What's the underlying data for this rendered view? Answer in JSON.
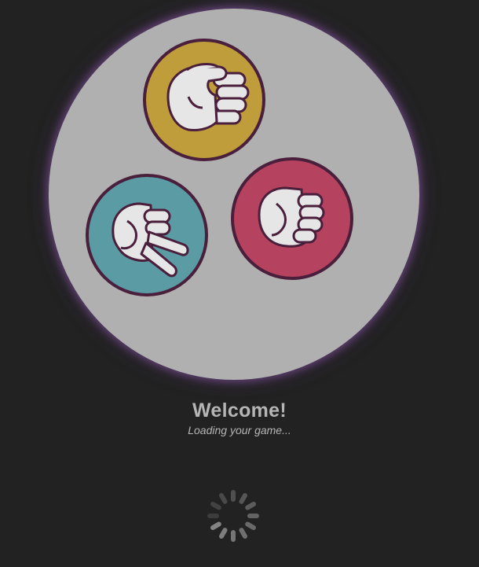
{
  "welcome": {
    "title": "Welcome!",
    "subtitle": "Loading your game..."
  },
  "hands": [
    {
      "choice": "paper",
      "color": "#bf9d3a"
    },
    {
      "choice": "rock",
      "color": "#b5425e"
    },
    {
      "choice": "scissors",
      "color": "#5a9ba4"
    }
  ],
  "colors": {
    "background": "#222222",
    "hero_circle": "#b0b0b0",
    "outline": "#4a1f3c",
    "skin": "#e6e6e6",
    "text": "#b5b5b5",
    "spinner": "#8a8a8a"
  },
  "icons": [
    "paper-hand-icon",
    "rock-hand-icon",
    "scissors-hand-icon",
    "loading-spinner-icon"
  ]
}
